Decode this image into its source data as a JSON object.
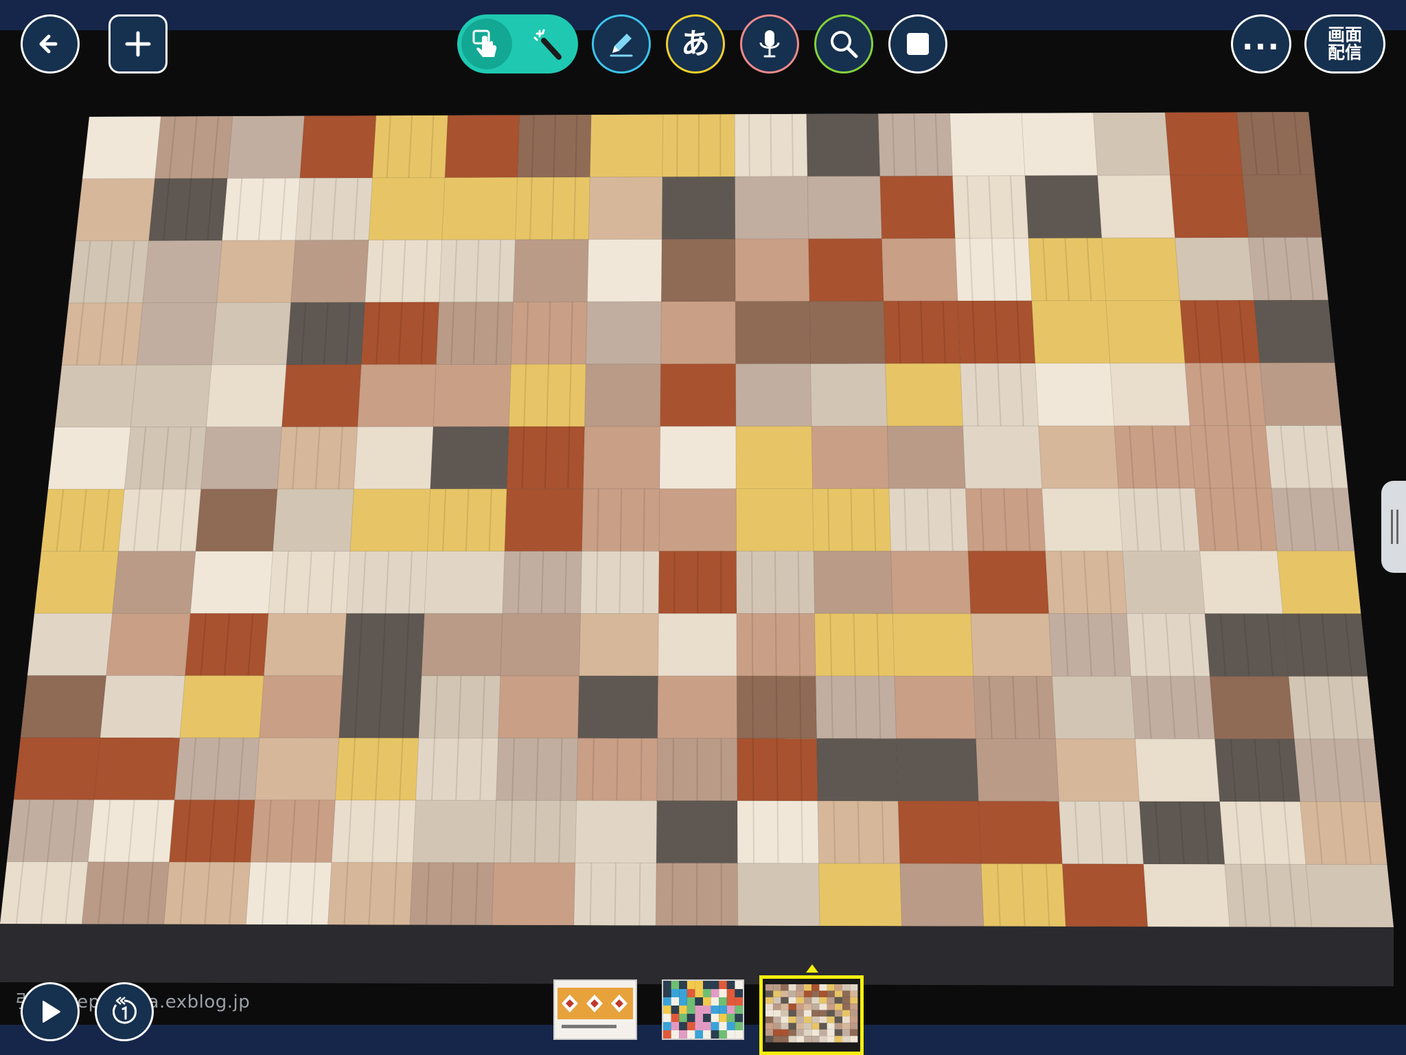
{
  "toolbar": {
    "text_tool_label": "あ",
    "more_label": "...",
    "cast_label_line1": "画面",
    "cast_label_line2": "配信"
  },
  "footer": {
    "credit_text": "引用：repair.ura.exblog.jp"
  },
  "colors": {
    "bar": "#15264a",
    "toggle_active": "#1fc9b1",
    "pen_ring": "#3cc4ec",
    "text_ring": "#f2d02b",
    "mic_ring": "#f08a8a",
    "zoom_ring": "#84d23a",
    "thumb_selected": "#f5ef10"
  },
  "icons": {
    "back": "arrow-left-icon",
    "add": "plus-icon",
    "pointer": "hand-pointer-icon",
    "wand": "magic-wand-icon",
    "pen": "pen-icon",
    "mic": "microphone-icon",
    "zoom": "magnifier-icon",
    "stop": "stop-square-icon",
    "play": "play-icon",
    "rewind": "rewind-one-icon"
  },
  "thumbnails": [
    {
      "id": "thumb-1",
      "selected": false
    },
    {
      "id": "thumb-2",
      "selected": false
    },
    {
      "id": "thumb-3",
      "selected": true
    }
  ]
}
